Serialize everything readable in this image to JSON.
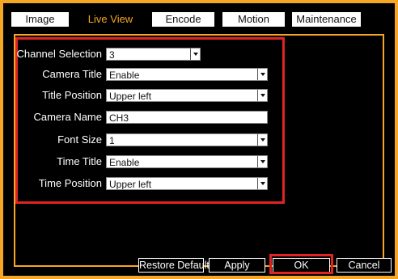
{
  "tabs": [
    {
      "label": "Image"
    },
    {
      "label": "Live View",
      "active": true
    },
    {
      "label": "Encode"
    },
    {
      "label": "Motion"
    },
    {
      "label": "Maintenance"
    }
  ],
  "fields": [
    {
      "label": "Channel Selection",
      "value": "3",
      "type": "dropdown"
    },
    {
      "label": "Camera Title",
      "value": "Enable",
      "type": "dropdown"
    },
    {
      "label": "Title Position",
      "value": "Upper left",
      "type": "dropdown"
    },
    {
      "label": "Camera Name",
      "value": "CH3",
      "type": "text"
    },
    {
      "label": "Font Size",
      "value": "1",
      "type": "dropdown"
    },
    {
      "label": "Time Title",
      "value": "Enable",
      "type": "dropdown"
    },
    {
      "label": "Time Position",
      "value": "Upper left",
      "type": "dropdown"
    }
  ],
  "buttons": {
    "restore_default": "Restore Default",
    "apply": "Apply",
    "ok": "OK",
    "cancel": "Cancel"
  },
  "colors": {
    "accent": "#f5a623",
    "highlight": "#e02424",
    "background": "#000000"
  }
}
